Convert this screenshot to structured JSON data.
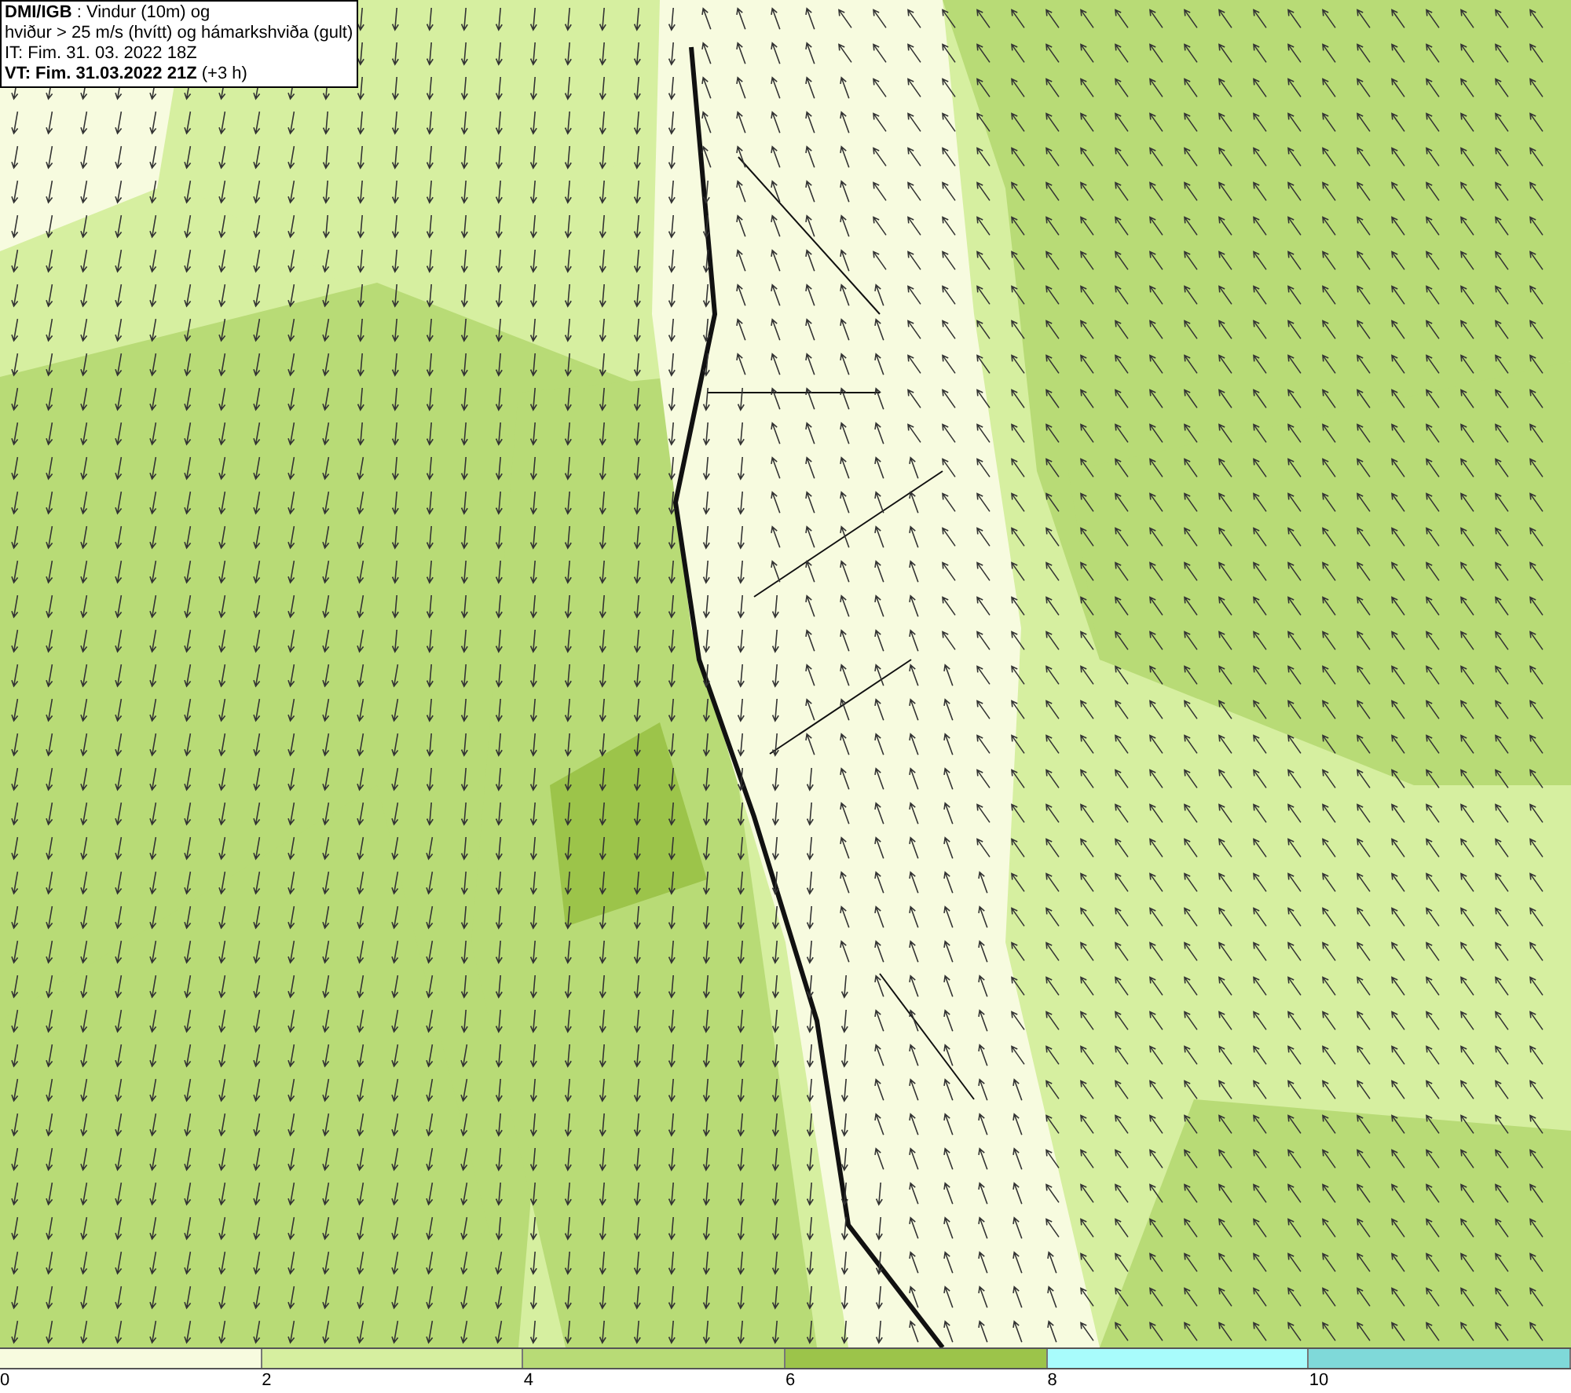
{
  "info_box": {
    "lines": [
      "**DMI/IGB** : Vindur (10m) og",
      "hviður > 25 m/s (hvítt) og hámarkshviða (gult)",
      "IT: Fim. 31. 03. 2022 18Z",
      "**VT: Fim. 31.03.2022 21Z** (+3 h)"
    ]
  },
  "legend": [
    {
      "label": "0",
      "color": "#f7fbdf"
    },
    {
      "label": "2",
      "color": "#d6efa0"
    },
    {
      "label": "4",
      "color": "#b8db76"
    },
    {
      "label": "6",
      "color": "#9cc44a"
    },
    {
      "label": "8",
      "color": "#a8fcfc"
    },
    {
      "label": "10",
      "color": "#7fd9d9"
    }
  ]
}
